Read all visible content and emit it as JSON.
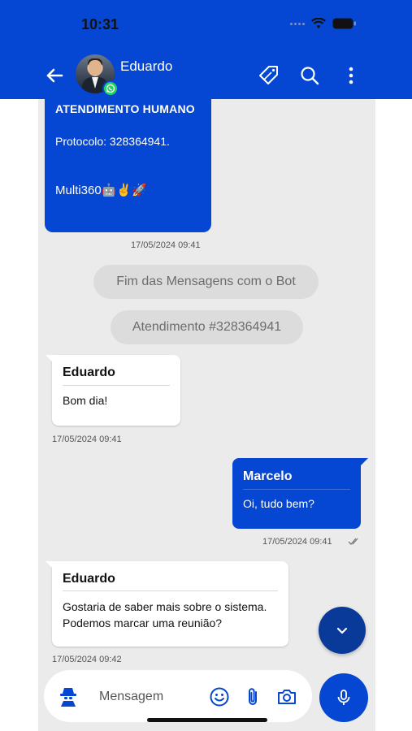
{
  "status_bar": {
    "time": "10:31"
  },
  "header": {
    "contact_name": "Eduardo"
  },
  "messages": {
    "bot": {
      "title": "ATENDIMENTO HUMANO",
      "protocol": "Protocolo: 328364941.",
      "signature": "Multi360🤖✌️🚀",
      "time": "17/05/2024 09:41"
    },
    "system_pills": [
      "Fim das Mensagens com o Bot",
      "Atendimento #328364941"
    ],
    "in1": {
      "sender": "Eduardo",
      "text": "Bom dia!",
      "time": "17/05/2024 09:41"
    },
    "out1": {
      "sender": "Marcelo",
      "text": "Oi, tudo bem?",
      "time": "17/05/2024 09:41"
    },
    "in2": {
      "sender": "Eduardo",
      "line1": "Gostaria de saber mais sobre o sistema.",
      "line2": "Podemos marcar uma reunião?",
      "time": "17/05/2024 09:42"
    }
  },
  "composer": {
    "placeholder": "Mensagem"
  },
  "colors": {
    "brand_blue": "#0546d2",
    "chat_bg": "#ebebeb",
    "whatsapp_green": "#25d366"
  },
  "icons": [
    "back-arrow-icon",
    "whatsapp-icon",
    "tag-icon",
    "search-icon",
    "more-vert-icon",
    "chevron-down-icon",
    "agent-icon",
    "emoji-icon",
    "attach-icon",
    "camera-icon",
    "mic-icon",
    "wifi-icon",
    "battery-icon",
    "double-check-icon"
  ]
}
